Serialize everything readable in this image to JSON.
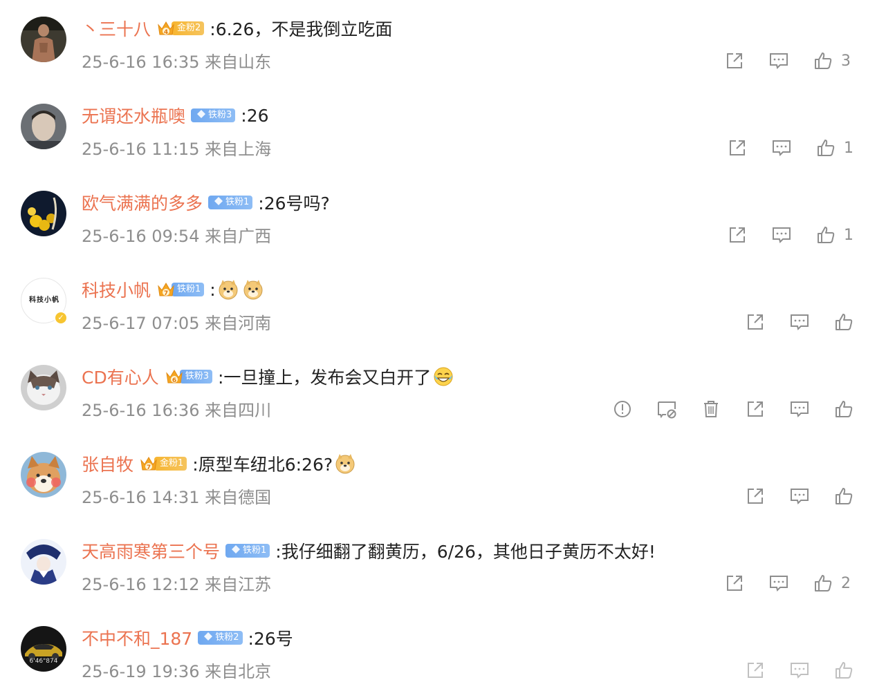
{
  "colors": {
    "username": "#eb7350",
    "meta": "#8e8e8e",
    "gold_badge": "#f7b531",
    "iron_badge": "#6fa8f0"
  },
  "comments": [
    {
      "user": "丶三十八",
      "fan_level": "4",
      "fan_label": "金粉2",
      "text": ":6.26，不是我倒立吃面",
      "time": "25-6-16 16:35",
      "location": "来自山东",
      "likes": "3"
    },
    {
      "user": "无谓还水瓶噢",
      "fan_label": "铁粉3",
      "text": ":26",
      "time": "25-6-16 11:15",
      "location": "来自上海",
      "likes": "1"
    },
    {
      "user": "欧气满满的多多",
      "fan_label": "铁粉1",
      "text": ":26号吗?",
      "time": "25-6-16 09:54",
      "location": "来自广西",
      "likes": "1"
    },
    {
      "user": "科技小帆",
      "fan_level": "7",
      "fan_label": "铁粉1",
      "text": ":",
      "avatar_text": "科技小帆",
      "emoji": [
        "doge-emoji",
        "doge-emoji"
      ],
      "time": "25-6-17 07:05",
      "location": "来自河南",
      "likes": ""
    },
    {
      "user": "CD有心人",
      "fan_level": "6",
      "fan_label": "铁粉3",
      "text": ":一旦撞上，发布会又白开了",
      "emoji": [
        "crying-laughing-emoji"
      ],
      "time": "25-6-16 16:36",
      "location": "来自四川",
      "likes": ""
    },
    {
      "user": "张自牧",
      "fan_level": "7",
      "fan_label": "金粉1",
      "text": ":原型车纽北6:26? ",
      "emoji": [
        "doge-emoji"
      ],
      "time": "25-6-16 14:31",
      "location": "来自德国",
      "likes": ""
    },
    {
      "user": "天高雨寒第三个号",
      "fan_label": "铁粉1",
      "text": ":我仔细翻了翻黄历，6/26，其他日子黄历不太好!",
      "time": "25-6-16 12:12",
      "location": "来自江苏",
      "likes": "2"
    },
    {
      "user": "不中不和_187",
      "fan_label": "铁粉2",
      "text": ":26号",
      "avatar_text": "6'46\"874",
      "time": "25-6-19 19:36",
      "location": "来自北京",
      "likes": ""
    }
  ]
}
